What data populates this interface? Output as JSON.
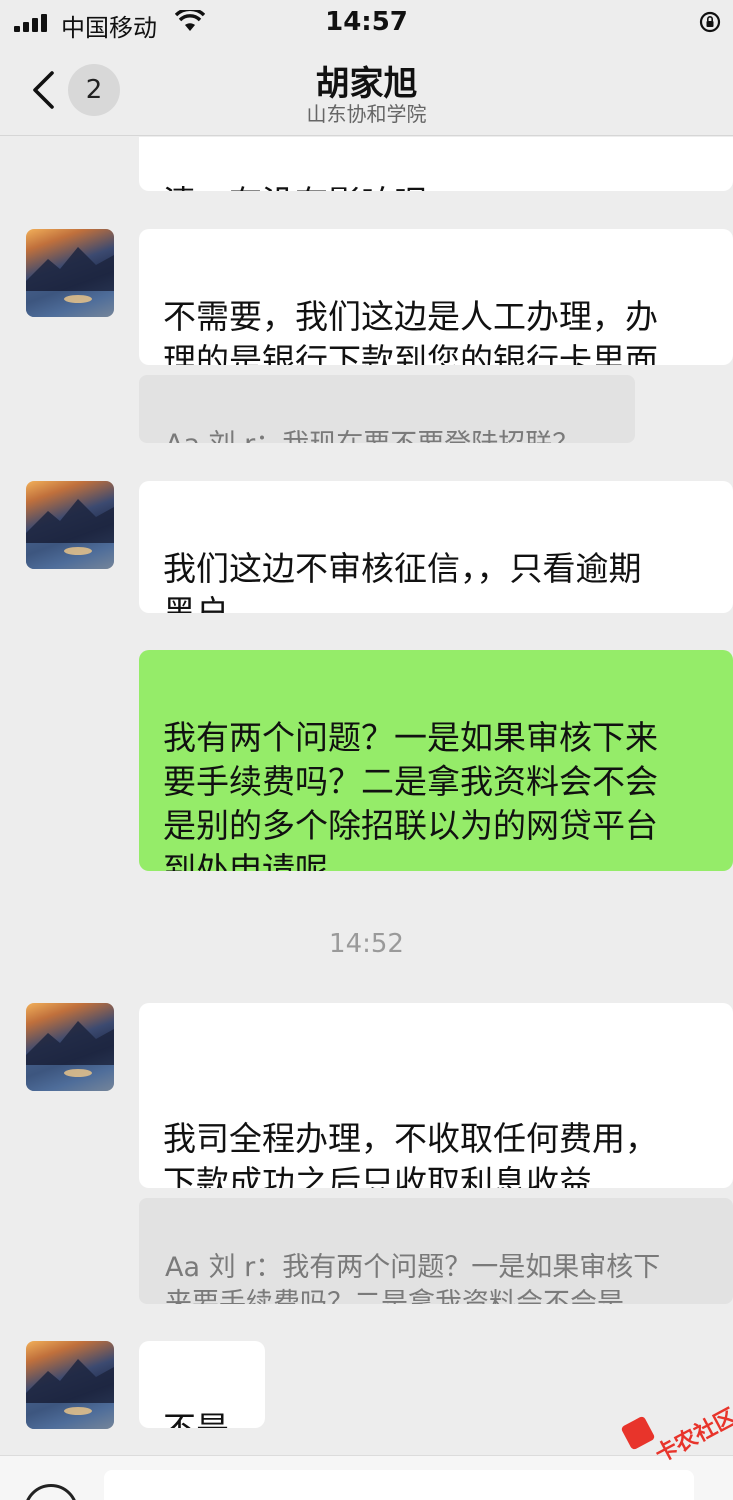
{
  "status_bar": {
    "carrier": "中国移动",
    "time": "14:57"
  },
  "nav": {
    "unread_count": "2",
    "title": "胡家旭",
    "subtitle": "山东协和学院"
  },
  "messages": [
    {
      "type": "incoming_partial",
      "text": "清，有没有影响呢"
    },
    {
      "type": "incoming",
      "text": "不需要，我们这边是人工办理，办\n理的是银行下款到您的银行卡里面"
    },
    {
      "type": "quote",
      "text": "Aa 刘 r：我现在要不要登陆招联？"
    },
    {
      "type": "incoming",
      "text": "我们这边不审核征信，，只看逾期\n黑户"
    },
    {
      "type": "outgoing",
      "text": "我有两个问题？一是如果审核下来\n要手续费吗？二是拿我资料会不会\n是别的多个除招联以为的网贷平台\n到处申请呢"
    },
    {
      "type": "time",
      "text": "14:52"
    },
    {
      "type": "incoming",
      "text": " 我司全程办理，不收取任何费用，\n下款成功之后只收取利息收益"
    },
    {
      "type": "quote",
      "text": "Aa 刘 r：我有两个问题？一是如果审核下\n来要手续费吗？二是拿我资料会不会是…"
    },
    {
      "type": "incoming",
      "text": "不是"
    }
  ],
  "watermark": "卡农社区",
  "colors": {
    "background": "#ededed",
    "incoming_bubble": "#ffffff",
    "outgoing_bubble": "#95ec69",
    "quote_bubble": "#e2e2e2"
  }
}
